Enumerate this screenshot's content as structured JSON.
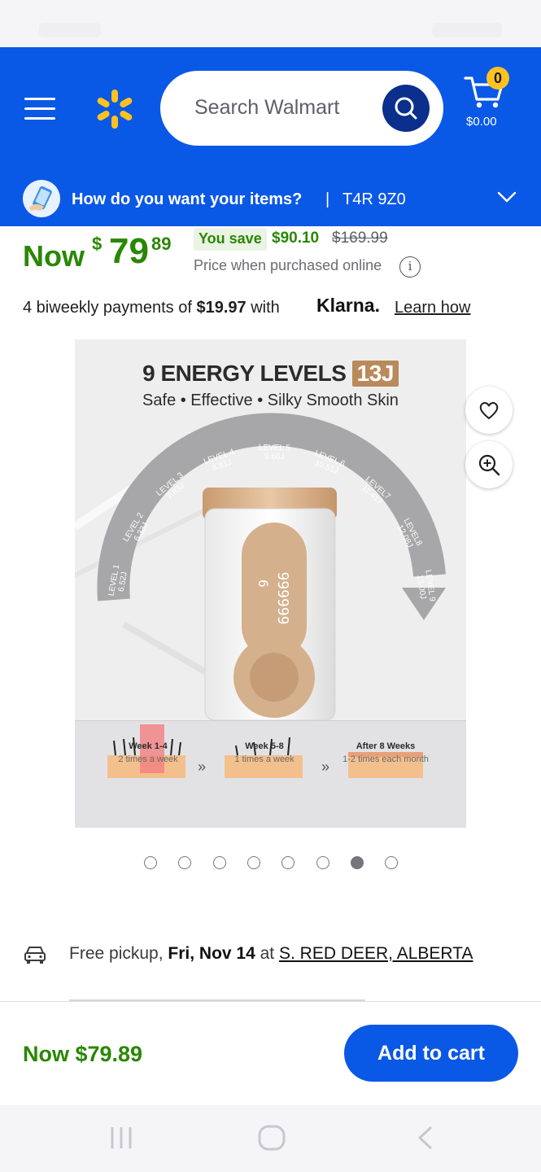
{
  "header": {
    "search_placeholder": "Search Walmart",
    "cart_count": "0",
    "cart_total": "$0.00",
    "brand_color": "#0a58e6",
    "spark_color": "#ffc220"
  },
  "delivery": {
    "question": "How do you want your items?",
    "separator": "|",
    "zip": "T4R 9Z0"
  },
  "price": {
    "now_label": "Now",
    "currency": "$",
    "whole": "79",
    "cents": "89",
    "you_save_label": "You save",
    "save_amount": "$90.10",
    "was_price": "$169.99",
    "online_note": "Price when purchased online",
    "price_color": "#2a8703"
  },
  "klarna": {
    "prefix": "4 biweekly payments of",
    "amount": "$19.97",
    "suffix": "with",
    "logo_text": "Klarna.",
    "link": "Learn how"
  },
  "product_image": {
    "title": "9 ENERGY LEVELS",
    "badge": "13J",
    "subtitle": "Safe • Effective • Silky Smooth Skin",
    "levels": [
      {
        "label": "LEVEL 1",
        "energy": "6.52J"
      },
      {
        "label": "LEVEL 2",
        "energy": "6.33J"
      },
      {
        "label": "LEVEL 3",
        "energy": "7.93J"
      },
      {
        "label": "LEVEL 4",
        "energy": "8.81J"
      },
      {
        "label": "LEVEL 5",
        "energy": "9.66J"
      },
      {
        "label": "LEVEL 6",
        "energy": "10.51J"
      },
      {
        "label": "LEVEL7",
        "energy": "11.41J"
      },
      {
        "label": "LEVEL8",
        "energy": "12.08J"
      },
      {
        "label": "LEVEL 9",
        "energy": "13.00J"
      }
    ],
    "device_display": "999999",
    "device_level": "6",
    "stages": [
      {
        "title": "Week 1-4",
        "sub": "2 times a week"
      },
      {
        "title": "Week 5-8",
        "sub": "1 times a week"
      },
      {
        "title": "After 8 Weeks",
        "sub": "1-2 times each month"
      }
    ],
    "arrow_glyph": "»"
  },
  "carousel": {
    "count": 8,
    "active_index": 6
  },
  "fulfillment": {
    "pickup_prefix": "Free pickup,",
    "pickup_date": "Fri, Nov 14",
    "pickup_at": "at",
    "pickup_store": "S. RED DEER, ALBERTA"
  },
  "bottom_bar": {
    "price": "Now $79.89",
    "add_to_cart": "Add to cart"
  },
  "icons": {
    "menu": "hamburger-icon",
    "logo": "walmart-spark-icon",
    "search": "search-icon",
    "cart": "cart-icon",
    "delivery": "delivery-phone-icon",
    "chevron": "chevron-down-icon",
    "info": "info-icon",
    "favorite": "heart-icon",
    "zoom": "zoom-in-icon",
    "pickup": "car-icon"
  }
}
